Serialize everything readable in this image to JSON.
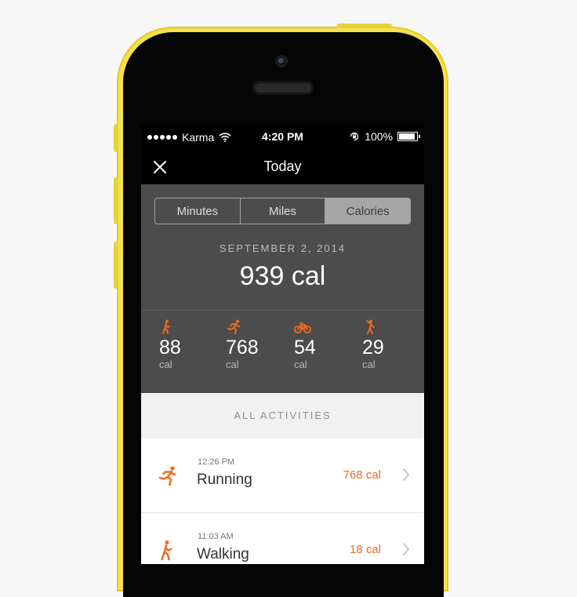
{
  "status_bar": {
    "carrier": "Karma",
    "time": "4:20 PM",
    "battery": "100%"
  },
  "nav": {
    "title": "Today"
  },
  "tabs": [
    {
      "label": "Minutes",
      "active": false
    },
    {
      "label": "Miles",
      "active": false
    },
    {
      "label": "Calories",
      "active": true
    }
  ],
  "summary": {
    "date": "SEPTEMBER 2, 2014",
    "total": "939 cal"
  },
  "stats": [
    {
      "icon": "walking-icon",
      "value": "88",
      "unit": "cal"
    },
    {
      "icon": "running-icon",
      "value": "768",
      "unit": "cal"
    },
    {
      "icon": "cycling-icon",
      "value": "54",
      "unit": "cal"
    },
    {
      "icon": "activity-icon",
      "value": "29",
      "unit": "cal"
    }
  ],
  "activities_header": "ALL ACTIVITIES",
  "activities": [
    {
      "icon": "running-icon",
      "time": "12:26 PM",
      "name": "Running",
      "calories": "768 cal"
    },
    {
      "icon": "walking-icon",
      "time": "11:03 AM",
      "name": "Walking",
      "calories": "18 cal"
    }
  ],
  "colors": {
    "accent": "#ef6b1f",
    "phone_body": "#f5e24a",
    "panel": "#4c4c4c"
  }
}
